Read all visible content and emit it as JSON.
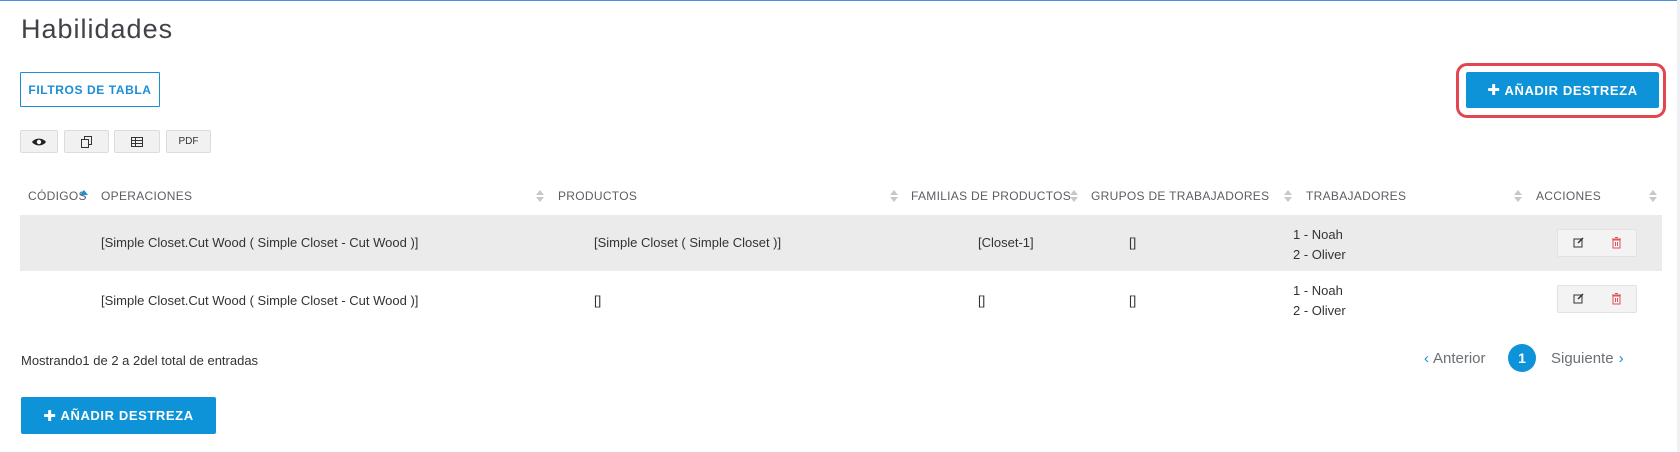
{
  "page": {
    "title": "Habilidades"
  },
  "toolbar": {
    "filters_label": "FILTROS DE TABLA",
    "add_label": "AÑADIR DESTREZA",
    "add_icon": "plus-icon",
    "export_buttons": [
      {
        "icon": "eye-icon"
      },
      {
        "icon": "copy-icon"
      },
      {
        "icon": "table-icon"
      },
      {
        "label": "PDF"
      }
    ]
  },
  "table": {
    "columns": [
      "CÓDIGOS",
      "OPERACIONES",
      "PRODUCTOS",
      "FAMILIAS DE PRODUCTOS",
      "GRUPOS DE TRABAJADORES",
      "TRABAJADORES",
      "ACCIONES"
    ],
    "rows": [
      {
        "codigo": "",
        "operaciones": "[Simple Closet.Cut Wood ( Simple Closet - Cut Wood )]",
        "productos": "[Simple Closet ( Simple Closet )]",
        "familias": "[Closet-1]",
        "grupos": "[]",
        "trabajadores": [
          "1 - Noah",
          "2 - Oliver"
        ]
      },
      {
        "codigo": "",
        "operaciones": "[Simple Closet.Cut Wood ( Simple Closet - Cut Wood )]",
        "productos": "[]",
        "familias": "[]",
        "grupos": "[]",
        "trabajadores": [
          "1 - Noah",
          "2 - Oliver"
        ]
      }
    ],
    "row_actions": [
      "edit-icon",
      "trash-icon"
    ]
  },
  "footer": {
    "info_prefix": "Mostrando",
    "info_range": "1 de 2 a 2",
    "info_suffix": "del total de entradas",
    "prev_label": "Anterior",
    "current_page": "1",
    "next_label": "Siguiente"
  },
  "colors": {
    "accent": "#0e93d8",
    "highlight": "#e24650",
    "delete": "#e0525a"
  }
}
